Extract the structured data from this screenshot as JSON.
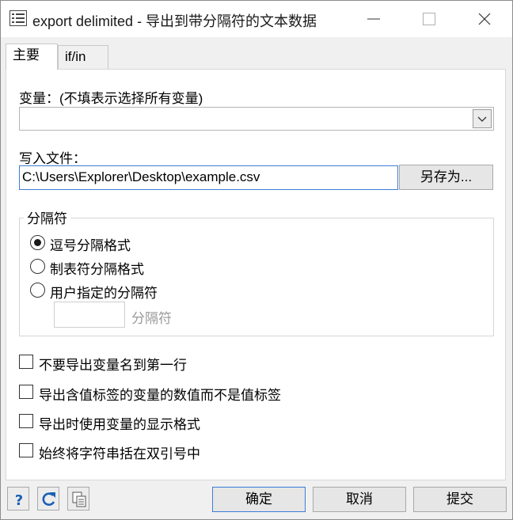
{
  "window": {
    "title": "export delimited - 导出到带分隔符的文本数据"
  },
  "tabs": [
    {
      "label": "主要"
    },
    {
      "label": "if/in"
    }
  ],
  "main": {
    "variables_label": "变量：(不填表示选择所有变量)",
    "variables_value": "",
    "write_file_label": "写入文件：",
    "file_path": "C:\\Users\\Explorer\\Desktop\\example.csv",
    "save_as_label": "另存为...",
    "delimiter": {
      "group_title": "分隔符",
      "options": [
        {
          "label": "逗号分隔格式",
          "selected": true
        },
        {
          "label": "制表符分隔格式",
          "selected": false
        },
        {
          "label": "用户指定的分隔符",
          "selected": false
        }
      ],
      "custom_value": "",
      "custom_label": "分隔符"
    },
    "checkboxes": [
      {
        "label": "不要导出变量名到第一行",
        "checked": false
      },
      {
        "label": "导出含值标签的变量的数值而不是值标签",
        "checked": false
      },
      {
        "label": "导出时使用变量的显示格式",
        "checked": false
      },
      {
        "label": "始终将字符串括在双引号中",
        "checked": false
      }
    ]
  },
  "footer": {
    "help_icon": "help-icon",
    "reset_icon": "refresh-icon",
    "copy_icon": "copy-icon",
    "ok_label": "确定",
    "cancel_label": "取消",
    "submit_label": "提交"
  }
}
